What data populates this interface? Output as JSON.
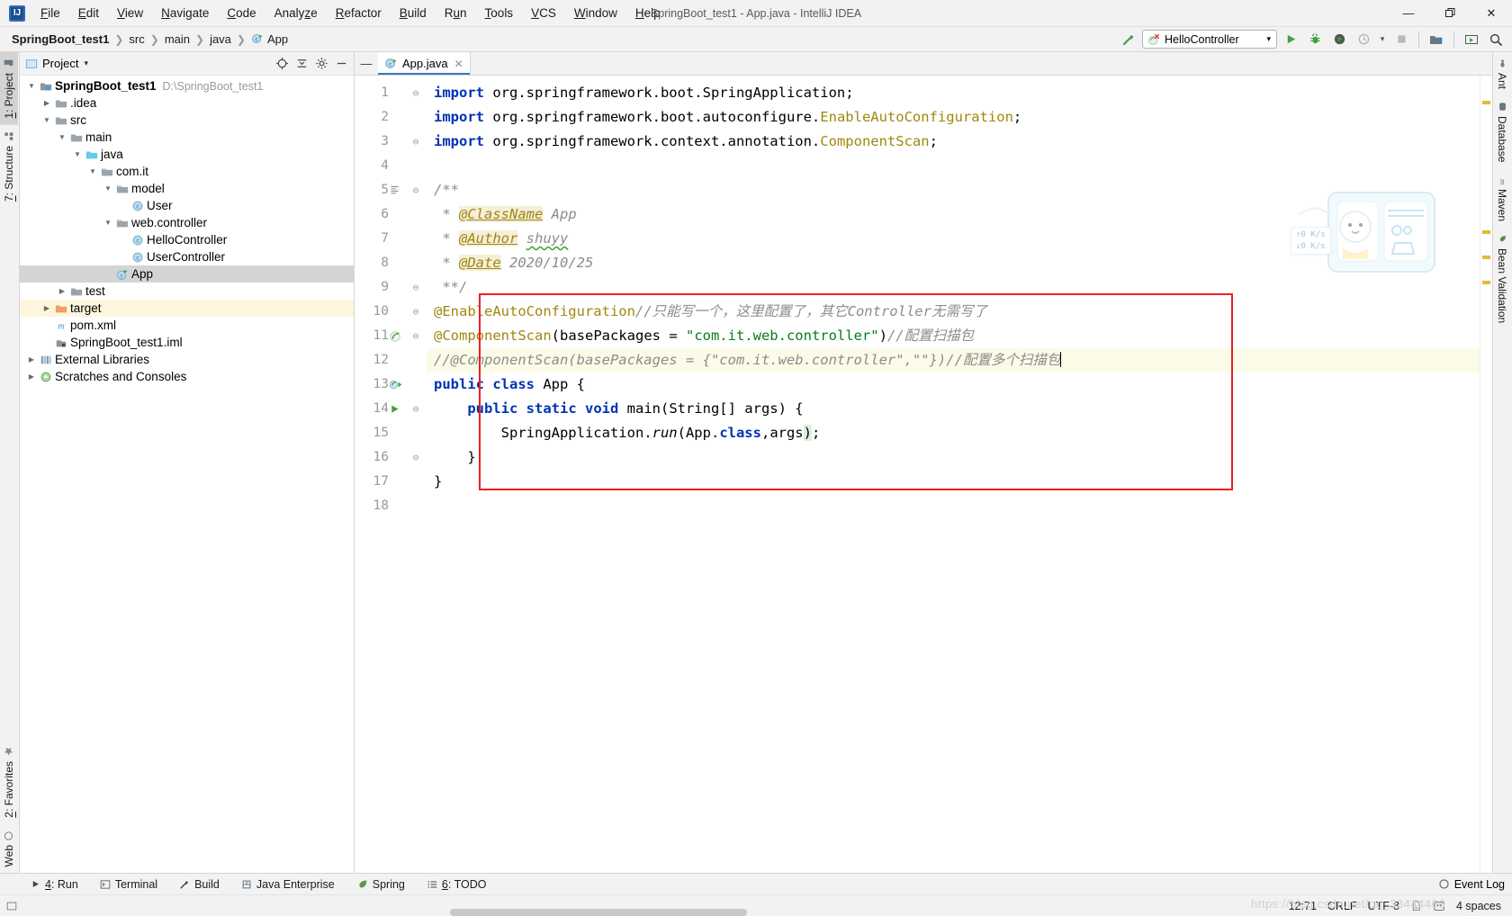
{
  "window": {
    "title": "SpringBoot_test1 - App.java - IntelliJ IDEA",
    "minimize": "—",
    "maximize": "❐",
    "close": "✕"
  },
  "menubar": [
    {
      "label": "File",
      "mnemonic": "F"
    },
    {
      "label": "Edit",
      "mnemonic": "E"
    },
    {
      "label": "View",
      "mnemonic": "V"
    },
    {
      "label": "Navigate",
      "mnemonic": "N"
    },
    {
      "label": "Code",
      "mnemonic": "C"
    },
    {
      "label": "Analyze",
      "mnemonic": "z"
    },
    {
      "label": "Refactor",
      "mnemonic": "R"
    },
    {
      "label": "Build",
      "mnemonic": "B"
    },
    {
      "label": "Run",
      "mnemonic": "u"
    },
    {
      "label": "Tools",
      "mnemonic": "T"
    },
    {
      "label": "VCS",
      "mnemonic": "V"
    },
    {
      "label": "Window",
      "mnemonic": "W"
    },
    {
      "label": "Help",
      "mnemonic": "H"
    }
  ],
  "breadcrumbs": [
    {
      "label": "SpringBoot_test1",
      "bold": true
    },
    {
      "label": "src",
      "bold": false
    },
    {
      "label": "main",
      "bold": false
    },
    {
      "label": "java",
      "bold": false
    },
    {
      "label": "App",
      "bold": false,
      "icon": "java-class-run-icon"
    }
  ],
  "toolbar": {
    "build_icon": "hammer-icon",
    "run_config_name": "HelloController",
    "run_config_icon": "spring-boot-error-icon",
    "dropdown_caret": "▾",
    "run_icon": "run-icon",
    "debug_icon": "debug-icon",
    "run_coverage_icon": "run-with-coverage-icon",
    "profiler_icon": "profiler-icon",
    "stop_icon": "stop-icon",
    "project_structure_icon": "project-structure-icon",
    "updates_icon": "update-icon",
    "search_icon": "search-everywhere-icon"
  },
  "left_strip": {
    "top": [
      {
        "label": "1: Project",
        "mnemonic": "1",
        "icon": "project-icon",
        "active": true
      },
      {
        "label": "7: Structure",
        "mnemonic": "7",
        "icon": "structure-icon",
        "active": false
      }
    ],
    "bottom": [
      {
        "label": "2: Favorites",
        "mnemonic": "2",
        "icon": "star-icon",
        "active": false
      },
      {
        "label": "Web",
        "mnemonic": "",
        "icon": "web-icon",
        "active": false
      }
    ]
  },
  "right_strip": [
    {
      "label": "Ant",
      "icon": "ant-icon"
    },
    {
      "label": "Database",
      "icon": "database-icon"
    },
    {
      "label": "Maven",
      "icon": "maven-icon"
    },
    {
      "label": "Bean Validation",
      "icon": "bean-validation-icon"
    }
  ],
  "project_panel": {
    "title": "Project",
    "caret": "▾",
    "actions": [
      {
        "name": "locate-icon",
        "glyph": "⊕"
      },
      {
        "name": "collapse-all-icon",
        "glyph": "≡"
      },
      {
        "name": "settings-gear-icon",
        "glyph": "⚙"
      },
      {
        "name": "hide-icon",
        "glyph": "—"
      }
    ],
    "tree": [
      {
        "depth": 0,
        "arrow": "down",
        "icon": "module-icon",
        "label": "SpringBoot_test1",
        "bold": true,
        "sub": "D:\\SpringBoot_test1",
        "state": "none"
      },
      {
        "depth": 1,
        "arrow": "right",
        "icon": "folder-icon",
        "label": ".idea",
        "bold": false,
        "sub": "",
        "state": "none"
      },
      {
        "depth": 1,
        "arrow": "down",
        "icon": "folder-icon",
        "label": "src",
        "bold": false,
        "sub": "",
        "state": "none"
      },
      {
        "depth": 2,
        "arrow": "down",
        "icon": "folder-icon",
        "label": "main",
        "bold": false,
        "sub": "",
        "state": "none"
      },
      {
        "depth": 3,
        "arrow": "down",
        "icon": "source-folder-icon",
        "label": "java",
        "bold": false,
        "sub": "",
        "state": "none"
      },
      {
        "depth": 4,
        "arrow": "down",
        "icon": "package-icon",
        "label": "com.it",
        "bold": false,
        "sub": "",
        "state": "none"
      },
      {
        "depth": 5,
        "arrow": "down",
        "icon": "package-icon",
        "label": "model",
        "bold": false,
        "sub": "",
        "state": "none"
      },
      {
        "depth": 6,
        "arrow": "none",
        "icon": "java-class-icon",
        "label": "User",
        "bold": false,
        "sub": "",
        "state": "none"
      },
      {
        "depth": 5,
        "arrow": "down",
        "icon": "package-icon",
        "label": "web.controller",
        "bold": false,
        "sub": "",
        "state": "none"
      },
      {
        "depth": 6,
        "arrow": "none",
        "icon": "java-class-icon",
        "label": "HelloController",
        "bold": false,
        "sub": "",
        "state": "none"
      },
      {
        "depth": 6,
        "arrow": "none",
        "icon": "java-class-icon",
        "label": "UserController",
        "bold": false,
        "sub": "",
        "state": "none"
      },
      {
        "depth": 5,
        "arrow": "none",
        "icon": "java-class-run-icon",
        "label": "App",
        "bold": false,
        "sub": "",
        "state": "selected"
      },
      {
        "depth": 2,
        "arrow": "right",
        "icon": "folder-icon",
        "label": "test",
        "bold": false,
        "sub": "",
        "state": "none"
      },
      {
        "depth": 1,
        "arrow": "right",
        "icon": "excluded-folder-icon",
        "label": "target",
        "bold": false,
        "sub": "",
        "state": "highlight"
      },
      {
        "depth": 1,
        "arrow": "none",
        "icon": "maven-pom-icon",
        "label": "pom.xml",
        "bold": false,
        "sub": "",
        "state": "none"
      },
      {
        "depth": 1,
        "arrow": "none",
        "icon": "iml-icon",
        "label": "SpringBoot_test1.iml",
        "bold": false,
        "sub": "",
        "state": "none"
      },
      {
        "depth": 0,
        "arrow": "right",
        "icon": "libraries-icon",
        "label": "External Libraries",
        "bold": false,
        "sub": "",
        "state": "none"
      },
      {
        "depth": 0,
        "arrow": "right",
        "icon": "scratches-icon",
        "label": "Scratches and Consoles",
        "bold": false,
        "sub": "",
        "state": "none"
      }
    ]
  },
  "editor": {
    "tab": {
      "label": "App.java",
      "icon": "java-class-run-icon",
      "close": "✕"
    },
    "collapse_icon": "—",
    "caret_position": "12:71",
    "lines": [
      {
        "n": 1,
        "fold": "start",
        "gicon": "",
        "hl": false,
        "tokens": [
          {
            "t": "import ",
            "c": "kw"
          },
          {
            "t": "org.springframework.boot.SpringApplication;",
            "c": "ident"
          }
        ]
      },
      {
        "n": 2,
        "fold": "",
        "gicon": "",
        "hl": false,
        "tokens": [
          {
            "t": "import ",
            "c": "kw"
          },
          {
            "t": "org.springframework.boot.autoconfigure.",
            "c": "ident"
          },
          {
            "t": "EnableAutoConfiguration",
            "c": "ann"
          },
          {
            "t": ";",
            "c": "ident"
          }
        ]
      },
      {
        "n": 3,
        "fold": "end",
        "gicon": "",
        "hl": false,
        "tokens": [
          {
            "t": "import ",
            "c": "kw"
          },
          {
            "t": "org.springframework.context.annotation.",
            "c": "ident"
          },
          {
            "t": "ComponentScan",
            "c": "ann"
          },
          {
            "t": ";",
            "c": "ident"
          }
        ]
      },
      {
        "n": 4,
        "fold": "",
        "gicon": "",
        "hl": false,
        "tokens": []
      },
      {
        "n": 5,
        "fold": "start",
        "gicon": "doc-render-icon",
        "hl": false,
        "tokens": [
          {
            "t": "/**",
            "c": "doc"
          }
        ]
      },
      {
        "n": 6,
        "fold": "",
        "gicon": "",
        "hl": false,
        "tokens": [
          {
            "t": " * ",
            "c": "doc"
          },
          {
            "t": "@ClassName",
            "c": "tagdoc"
          },
          {
            "t": " App",
            "c": "doc"
          }
        ]
      },
      {
        "n": 7,
        "fold": "",
        "gicon": "",
        "hl": false,
        "tokens": [
          {
            "t": " * ",
            "c": "doc"
          },
          {
            "t": "@Author",
            "c": "tagdoc"
          },
          {
            "t": " ",
            "c": "doc"
          },
          {
            "t": "shuyy",
            "c": "doc squiggle"
          }
        ]
      },
      {
        "n": 8,
        "fold": "",
        "gicon": "",
        "hl": false,
        "tokens": [
          {
            "t": " * ",
            "c": "doc"
          },
          {
            "t": "@Date",
            "c": "tagdoc"
          },
          {
            "t": " 2020/10/25",
            "c": "doc"
          }
        ]
      },
      {
        "n": 9,
        "fold": "end",
        "gicon": "",
        "hl": false,
        "tokens": [
          {
            "t": " **/",
            "c": "doc"
          }
        ]
      },
      {
        "n": 10,
        "fold": "start",
        "gicon": "",
        "hl": false,
        "tokens": [
          {
            "t": "@EnableAutoConfiguration",
            "c": "ann"
          },
          {
            "t": "//只能写一个，这里配置了，其它Controller无需写了",
            "c": "cmt"
          }
        ]
      },
      {
        "n": 11,
        "fold": "start",
        "gicon": "spring-bean-icon",
        "hl": false,
        "tokens": [
          {
            "t": "@ComponentScan",
            "c": "ann"
          },
          {
            "t": "(",
            "c": "ident"
          },
          {
            "t": "basePackages",
            "c": "ident"
          },
          {
            "t": " = ",
            "c": "ident"
          },
          {
            "t": "\"com.it.web.controller\"",
            "c": "str"
          },
          {
            "t": ")",
            "c": "ident"
          },
          {
            "t": "//配置扫描包",
            "c": "cmt"
          }
        ]
      },
      {
        "n": 12,
        "fold": "",
        "gicon": "",
        "hl": true,
        "tokens": [
          {
            "t": "//@ComponentScan(basePackages = {\"com.it.web.controller\",\"\"})//配置多个扫描包",
            "c": "cmt"
          }
        ]
      },
      {
        "n": 13,
        "fold": "",
        "gicon": "spring-run-icon",
        "hl": false,
        "tokens": [
          {
            "t": "public ",
            "c": "kw"
          },
          {
            "t": "class ",
            "c": "kw"
          },
          {
            "t": "App ",
            "c": "ident"
          },
          {
            "t": "{",
            "c": "ident"
          }
        ]
      },
      {
        "n": 14,
        "fold": "start",
        "gicon": "run-gutter-icon",
        "hl": false,
        "tokens": [
          {
            "t": "    ",
            "c": "ident"
          },
          {
            "t": "public ",
            "c": "kw"
          },
          {
            "t": "static ",
            "c": "kw"
          },
          {
            "t": "void ",
            "c": "kw"
          },
          {
            "t": "main",
            "c": "ident"
          },
          {
            "t": "(String[] args) {",
            "c": "ident"
          }
        ]
      },
      {
        "n": 15,
        "fold": "",
        "gicon": "",
        "hl": false,
        "tokens": [
          {
            "t": "        SpringApplication.",
            "c": "ident"
          },
          {
            "t": "run",
            "c": "italic"
          },
          {
            "t": "(App.",
            "c": "ident"
          },
          {
            "t": "class",
            "c": "kw"
          },
          {
            "t": ",args",
            "c": "ident"
          },
          {
            "t": ")",
            "c": "paren-hl"
          },
          {
            "t": ";",
            "c": "ident"
          }
        ]
      },
      {
        "n": 16,
        "fold": "end",
        "gicon": "",
        "hl": false,
        "tokens": [
          {
            "t": "    }",
            "c": "ident"
          }
        ]
      },
      {
        "n": 17,
        "fold": "",
        "gicon": "",
        "hl": false,
        "tokens": [
          {
            "t": "}",
            "c": "ident"
          }
        ]
      },
      {
        "n": 18,
        "fold": "",
        "gicon": "",
        "hl": false,
        "tokens": []
      }
    ],
    "annotation_box": {
      "name": "red-highlight-box",
      "color": "#f01e1e"
    },
    "net_widget": {
      "up": "↑0 K/s",
      "down": "↓0 K/s"
    }
  },
  "bottom_bar": [
    {
      "label": "4: Run",
      "mnemonic": "4",
      "icon": "run-icon"
    },
    {
      "label": "Terminal",
      "mnemonic": "",
      "icon": "terminal-icon"
    },
    {
      "label": "Build",
      "mnemonic": "",
      "icon": "hammer-icon"
    },
    {
      "label": "Java Enterprise",
      "mnemonic": "",
      "icon": "java-enterprise-icon"
    },
    {
      "label": "Spring",
      "mnemonic": "",
      "icon": "spring-leaf-icon"
    },
    {
      "label": "6: TODO",
      "mnemonic": "6",
      "icon": "todo-icon"
    }
  ],
  "event_log": {
    "label": "Event Log",
    "icon": "event-log-icon"
  },
  "statusbar": {
    "position": "12:71",
    "line_separator": "CRLF",
    "encoding": "UTF-8",
    "lock_icon": "write-access-icon",
    "reader_icon": "reader-mode-icon",
    "indent": "4 spaces",
    "watermark": "https://blog.csdn.net/qq_33444466"
  }
}
